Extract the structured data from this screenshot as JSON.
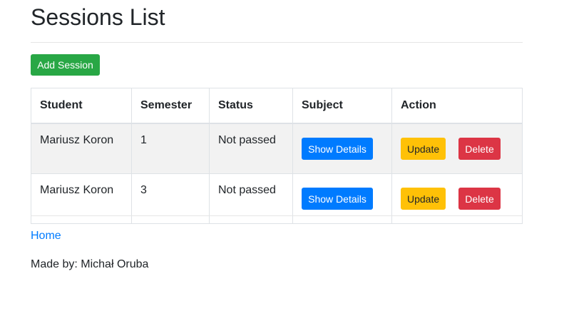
{
  "page": {
    "title": "Sessions List"
  },
  "toolbar": {
    "add_label": "Add Session"
  },
  "table": {
    "headers": [
      "Student",
      "Semester",
      "Status",
      "Subject",
      "Action"
    ],
    "rows": [
      {
        "student": "Mariusz Koron",
        "semester": "1",
        "status": "Not passed",
        "details_label": "Show Details",
        "update_label": "Update",
        "delete_label": "Delete"
      },
      {
        "student": "Mariusz Koron",
        "semester": "3",
        "status": "Not passed",
        "details_label": "Show Details",
        "update_label": "Update",
        "delete_label": "Delete"
      }
    ]
  },
  "footer": {
    "home_link": "Home",
    "made_by": "Made by: Michał Oruba"
  },
  "colors": {
    "success": "#28a745",
    "primary": "#007bff",
    "warning": "#ffc107",
    "danger": "#dc3545"
  }
}
